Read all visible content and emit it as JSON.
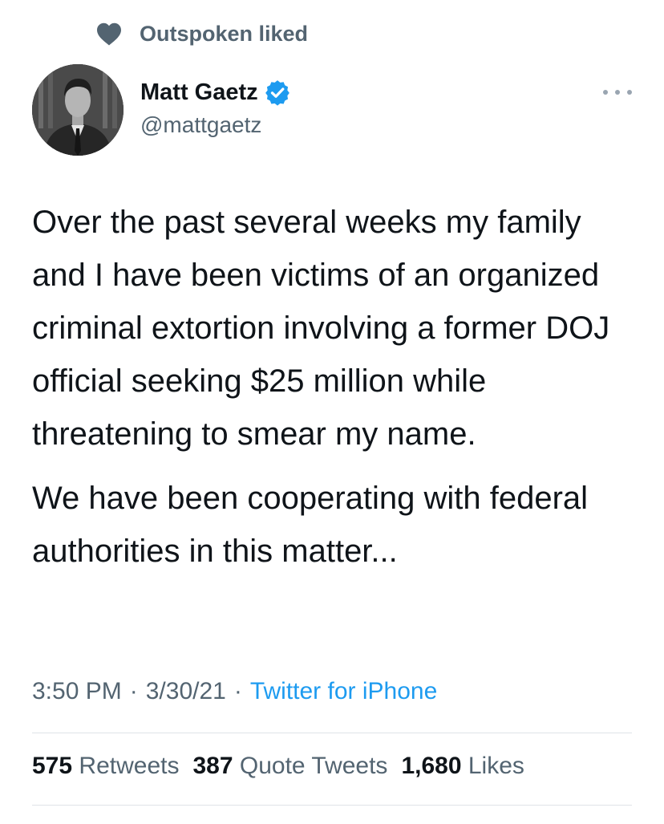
{
  "social_context": {
    "icon": "heart-icon",
    "text": "Outspoken liked"
  },
  "author": {
    "display_name": "Matt Gaetz",
    "handle": "@mattgaetz",
    "verified_icon": "verified-badge-icon"
  },
  "menu": {
    "icon": "more-options-icon"
  },
  "tweet": {
    "paragraphs": [
      "Over the past several weeks my family and I have been victims of an organized criminal extortion involving a former DOJ official seeking $25 million while threatening to smear my name.",
      "We have been cooperating with federal authorities in this matter..."
    ]
  },
  "meta": {
    "time": "3:50 PM",
    "separator": "·",
    "date": "3/30/21",
    "source": "Twitter for iPhone"
  },
  "stats": {
    "retweets_count": "575",
    "retweets_label": "Retweets",
    "quote_tweets_count": "387",
    "quote_tweets_label": "Quote Tweets",
    "likes_count": "1,680",
    "likes_label": "Likes"
  },
  "colors": {
    "text_primary": "#0f1419",
    "text_secondary": "#536471",
    "link_blue": "#1d9bf0",
    "verified_blue": "#1d9bf0",
    "divider": "#dfe3e7"
  }
}
